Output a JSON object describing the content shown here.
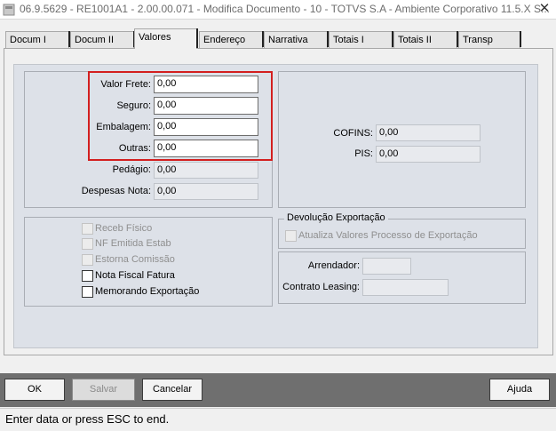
{
  "window": {
    "title": "06.9.5629 - RE1001A1 - 2.00.00.071 - Modifica Documento - 10 - TOTVS S.A - Ambiente Corporativo 11.5.X S...",
    "close_glyph": "✕"
  },
  "tabs": [
    {
      "label": "Docum I"
    },
    {
      "label": "Docum II"
    },
    {
      "label": "Valores"
    },
    {
      "label": "Endereço"
    },
    {
      "label": "Narrativa"
    },
    {
      "label": "Totais I"
    },
    {
      "label": "Totais II"
    },
    {
      "label": "Transp"
    }
  ],
  "fields": {
    "valor_frete": {
      "label": "Valor Frete:",
      "value": "0,00"
    },
    "seguro": {
      "label": "Seguro:",
      "value": "0,00"
    },
    "embalagem": {
      "label": "Embalagem:",
      "value": "0,00"
    },
    "outras": {
      "label": "Outras:",
      "value": "0,00"
    },
    "pedagio": {
      "label": "Pedágio:",
      "value": "0,00"
    },
    "despesas_nota": {
      "label": "Despesas Nota:",
      "value": "0,00"
    },
    "cofins": {
      "label": "COFINS:",
      "value": "0,00"
    },
    "pis": {
      "label": "PIS:",
      "value": "0,00"
    },
    "arrendador": {
      "label": "Arrendador:",
      "value": ""
    },
    "contrato_leasing": {
      "label": "Contrato Leasing:",
      "value": ""
    }
  },
  "checkboxes": {
    "receb_fisico": {
      "label": "Receb Físico"
    },
    "nf_emitida_estab": {
      "label": "NF Emitida Estab"
    },
    "estorna_comissao": {
      "label": "Estorna Comissão"
    },
    "nota_fiscal_fatura": {
      "label": "Nota Fiscal Fatura"
    },
    "memorando_exportacao": {
      "label": "Memorando Exportação"
    },
    "atualiza_valores": {
      "label": "Atualiza Valores Processo de Exportação"
    }
  },
  "devolucao": {
    "title": "Devolução Exportação"
  },
  "buttons": {
    "ok": "OK",
    "salvar": "Salvar",
    "cancelar": "Cancelar",
    "ajuda": "Ajuda"
  },
  "status_text": "Enter data or press ESC to end.",
  "colors": {
    "highlight": "#d31f1f",
    "button_bar": "#6f6f6f"
  }
}
